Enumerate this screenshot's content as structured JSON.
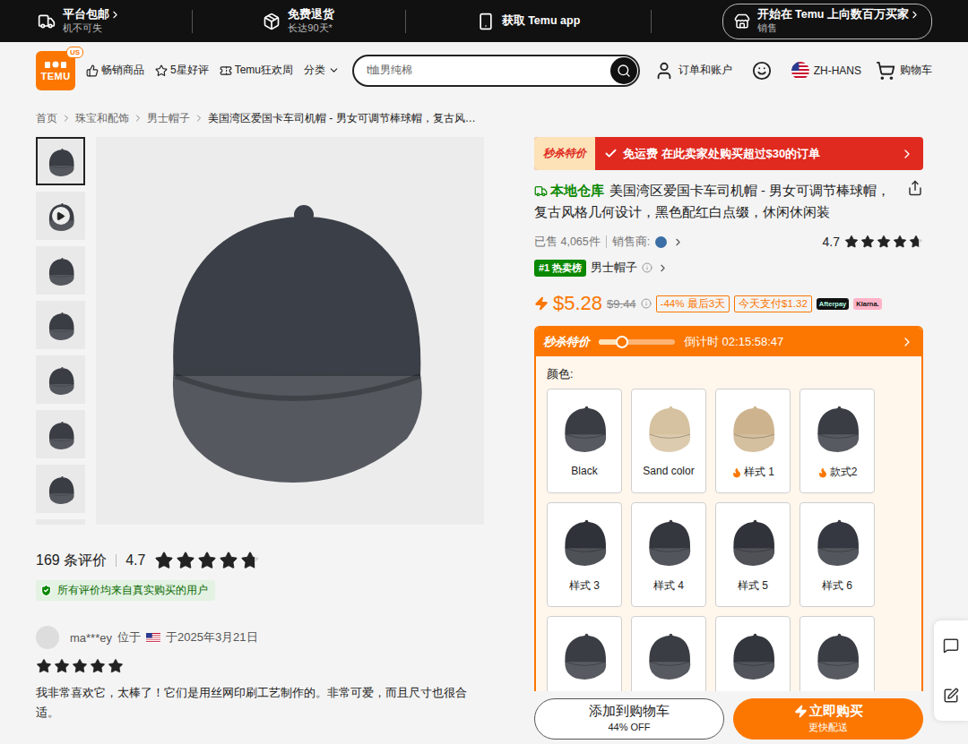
{
  "top_bar": {
    "items": [
      {
        "title": "平台包邮",
        "subtitle": "机不可失",
        "arrow": true,
        "kind": "truck"
      },
      {
        "title": "免费退货",
        "subtitle": "长达90天*",
        "arrow": false,
        "kind": "package"
      },
      {
        "title": "获取 Temu app",
        "arrow": false,
        "kind": "phone"
      }
    ],
    "seller_button": {
      "line1": "开始在 Temu 上向数百万买家",
      "line2": "销售"
    }
  },
  "header": {
    "logo": {
      "text": "TEMU",
      "badge": "US"
    },
    "nav": [
      {
        "label": "畅销商品",
        "kind": "thumbs"
      },
      {
        "label": "5星好评",
        "kind": "star"
      },
      {
        "label": "Temu狂欢周",
        "kind": "ticket"
      },
      {
        "label": "分类",
        "kind": "dropdown"
      }
    ],
    "search": {
      "placeholder": "t恤男纯棉"
    },
    "account": "订单和账户",
    "language": "ZH-HANS",
    "cart": "购物车"
  },
  "breadcrumb": [
    "首页",
    "珠宝和配饰",
    "男士帽子",
    "美国湾区爱国卡车司机帽 - 男女可调节棒球帽，复古风…"
  ],
  "gallery": {
    "thumbnails": [
      {
        "kind": "image",
        "selected": true
      },
      {
        "kind": "video",
        "selected": false
      },
      {
        "kind": "image",
        "selected": false
      },
      {
        "kind": "image",
        "selected": false
      },
      {
        "kind": "image",
        "selected": false
      },
      {
        "kind": "image",
        "selected": false
      },
      {
        "kind": "image",
        "selected": false
      },
      {
        "kind": "image",
        "selected": false
      }
    ]
  },
  "reviews": {
    "count": "169 条评价",
    "rating": "4.7",
    "stars": 4.7,
    "verified": "所有评价均来自真实购买的用户",
    "items": [
      {
        "user": "ma***ey",
        "location": "位于",
        "date": "于2025年3月21日",
        "stars": 5,
        "text": "我非常喜欢它，太棒了！它们是用丝网印刷工艺制作的。非常可爱，而且尺寸也很合适。"
      }
    ]
  },
  "product": {
    "banner": {
      "label": "秒杀特价",
      "text": "免运费 在此卖家处购买超过$30的订单"
    },
    "tag": "本地仓库",
    "title": "美国湾区爱国卡车司机帽 - 男女可调节棒球帽，复古风格几何设计，黑色配红白点缀，休闲休闲装",
    "sold": "已售 4,065件",
    "seller": "销售商:",
    "rating": "4.7",
    "stars": 4.7,
    "rank_badge": "#1 热卖榜",
    "rank_category": "男士帽子",
    "price": "$5.28",
    "original_price": "$9.44",
    "discount": "-44% 最后3天",
    "installment": "今天支付$1.32",
    "pay_badges": [
      {
        "label": "Afterpay",
        "color": "#111111"
      },
      {
        "label": "Klarna.",
        "color": "#ffb3c7"
      }
    ]
  },
  "flash_sale": {
    "title": "秒杀特价",
    "level": 0.3,
    "countdown": "倒计时 02:15:58:47",
    "color_label": "颜色:",
    "swatches": [
      {
        "label": "Black",
        "color": "#3a3d44",
        "hot": false,
        "selected": false
      },
      {
        "label": "Sand color",
        "color": "#d6c2a0",
        "hot": false,
        "selected": false
      },
      {
        "label": "样式 1",
        "color": "#cdb48e",
        "hot": true,
        "selected": false
      },
      {
        "label": "款式2",
        "color": "#3a3d44",
        "hot": true,
        "selected": false
      },
      {
        "label": "样式 3",
        "color": "#2f3238",
        "hot": false,
        "selected": false
      },
      {
        "label": "样式 4",
        "color": "#34373e",
        "hot": false,
        "selected": false
      },
      {
        "label": "样式 5",
        "color": "#30333a",
        "hot": false,
        "selected": false
      },
      {
        "label": "样式 6",
        "color": "#353840",
        "hot": false,
        "selected": false
      },
      {
        "color": "#3a3d44",
        "hot": false,
        "selected": false
      },
      {
        "color": "#3a3d44",
        "hot": false,
        "selected": false
      },
      {
        "color": "#33363d",
        "hot": false,
        "selected": false
      },
      {
        "color": "#3a3d44",
        "hot": false,
        "selected": false
      }
    ]
  },
  "actions": [
    {
      "label": "添加到购物车",
      "sub": "44% OFF",
      "kind": "outline"
    },
    {
      "label": "立即购买",
      "sub": "更快配送",
      "kind": "primary"
    }
  ]
}
